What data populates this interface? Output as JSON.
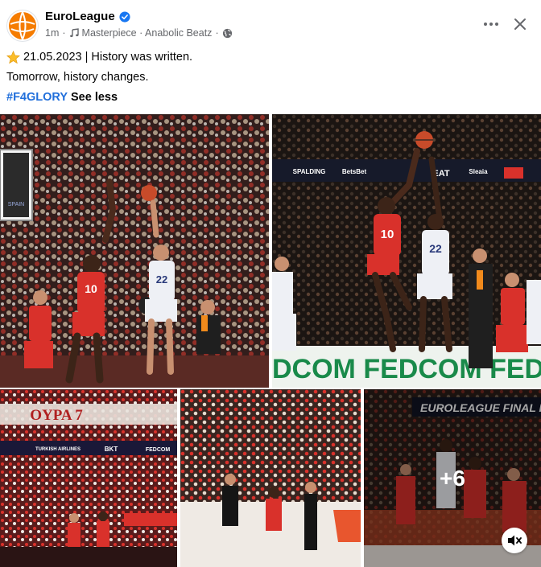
{
  "post": {
    "page_name": "EuroLeague",
    "verified_icon": "verified-badge-icon",
    "time": "1m",
    "separator": "·",
    "music_icon": "music-note-icon",
    "audio_track": "Masterpiece · Anabolic Beatz",
    "audience_icon": "globe-icon",
    "more_icon": "more-horizontal-icon",
    "close_icon": "close-icon"
  },
  "caption": {
    "star_icon": "star-emoji-icon",
    "line1": "21.05.2023 | History was written.",
    "line2": "Tomorrow, history changes.",
    "hashtag": "#F4GLORY",
    "see_less": "See less"
  },
  "photos": {
    "scoreboard_text": "SPAIN",
    "photo1_jersey_red": "10",
    "photo1_jersey_white": "22",
    "photo2_jersey_red": "10",
    "photo2_jersey_white": "22",
    "photo2_banner": "DCOM FEDCOM FEDCOM FED",
    "photo2_sponsors": [
      "SPALDING",
      "BetsBet",
      "EAT",
      "Sleaia"
    ],
    "photo3_banner": "OYPA 7",
    "photo3_sponsors": [
      "TURKISH AIRLINES",
      "BKT",
      "FEDCOM"
    ],
    "photo5_banner": "EUROLEAGUE FINAL F",
    "more_count": "+6",
    "mute_icon": "speaker-muted-icon"
  },
  "colors": {
    "link_blue": "#216fdb",
    "olympiacos_red": "#d9312b",
    "madrid_white": "#eef0f5",
    "muted_text": "#65676b"
  }
}
